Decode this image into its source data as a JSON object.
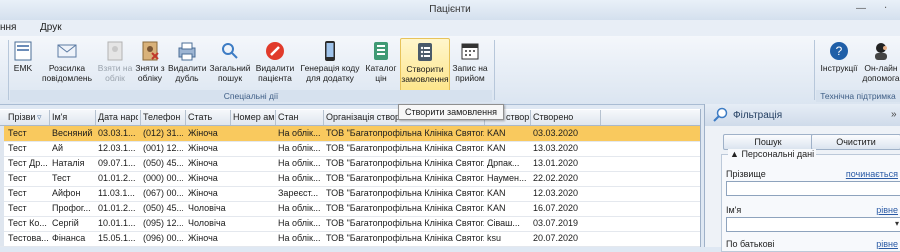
{
  "window": {
    "title": "Пацієнти"
  },
  "menu": [
    "ння",
    "Друк"
  ],
  "ribbon": {
    "buttons": [
      {
        "label": "EMK",
        "icon": "emk-icon",
        "disabled": false
      },
      {
        "label": "Розсилка повідомлень",
        "icon": "envelope-icon",
        "disabled": false
      },
      {
        "label": "Взяти на облік",
        "icon": "take-record-icon",
        "disabled": true
      },
      {
        "label": "Зняти з обліку",
        "icon": "remove-record-icon",
        "disabled": false
      },
      {
        "label": "Видалити дубль",
        "icon": "printer-icon",
        "disabled": false
      },
      {
        "label": "Загальний пошук",
        "icon": "search-icon",
        "disabled": false
      },
      {
        "label": "Видалити пацієнта",
        "icon": "delete-icon",
        "disabled": false
      },
      {
        "label": "Генерація коду для додатку",
        "icon": "phone-icon",
        "disabled": false
      },
      {
        "label": "Каталог цін",
        "icon": "catalog-icon",
        "disabled": false
      },
      {
        "label": "Створити замовлення",
        "icon": "order-icon",
        "disabled": false,
        "active": true
      },
      {
        "label": "Запис на прийом",
        "icon": "calendar-icon",
        "disabled": false
      }
    ],
    "group_special": "Спеціальні дії",
    "right_buttons": [
      {
        "label": "Інструкції",
        "icon": "help-icon"
      },
      {
        "label": "Он-лайн допомога",
        "icon": "online-help-icon"
      }
    ],
    "group_support": "Технічна підтримка"
  },
  "tooltip": "Створити замовлення",
  "grid": {
    "columns": [
      "Прізви",
      "Ім'я",
      "Дата нарс",
      "Телефон",
      "Стать",
      "Номер ам",
      "Стан",
      "Організація створ",
      "створ",
      "Створено"
    ],
    "rows": [
      [
        "Тест",
        "Весняний",
        "03.03.1...",
        "(012) 31...",
        "Жіноча",
        "",
        "На облік...",
        "ТОВ \"Багатопрофільна Клініка Святог...",
        "KAN",
        "03.03.2020"
      ],
      [
        "Тест",
        "Ай",
        "12.03.1...",
        "(001) 12...",
        "Жіноча",
        "",
        "На облік...",
        "ТОВ \"Багатопрофільна Клініка Святог...",
        "KAN",
        "13.03.2020"
      ],
      [
        "Тест Др...",
        "Наталія",
        "09.07.1...",
        "(050) 45...",
        "Жіноча",
        "",
        "На облік...",
        "ТОВ \"Багатопрофільна Клініка Святог...",
        "Дрпак...",
        "13.01.2020"
      ],
      [
        "Тест",
        "Тест",
        "01.01.2...",
        "(000) 00...",
        "Жіноча",
        "",
        "На облік...",
        "ТОВ \"Багатопрофільна Клініка Святог...",
        "Наумен...",
        "22.02.2020"
      ],
      [
        "Тест",
        "Айфон",
        "11.03.1...",
        "(067) 00...",
        "Жіноча",
        "",
        "Зареєст...",
        "ТОВ \"Багатопрофільна Клініка Святог...",
        "KAN",
        "12.03.2020"
      ],
      [
        "Тест",
        "Профог...",
        "01.01.2...",
        "(050) 45...",
        "Чоловіча",
        "",
        "На облік...",
        "ТОВ \"Багатопрофільна Клініка Святог...",
        "KAN",
        "16.07.2020"
      ],
      [
        "Тест Ко...",
        "Сергій",
        "10.01.1...",
        "(095) 12...",
        "Чоловіча",
        "",
        "На облік...",
        "ТОВ \"Багатопрофільна Клініка Святог...",
        "Сіваш...",
        "03.07.2019"
      ],
      [
        "Тестова...",
        "Фінанса",
        "15.05.1...",
        "(096) 00...",
        "Жіноча",
        "",
        "На облік...",
        "ТОВ \"Багатопрофільна Клініка Святог...",
        "ksu",
        "20.07.2020"
      ]
    ]
  },
  "filter": {
    "title": "Фільтрація",
    "search": "Пошук",
    "clear": "Очистити",
    "section": "Персональні дані",
    "fields": [
      {
        "label": "Прізвище",
        "mode": "починається"
      },
      {
        "label": "Ім'я",
        "mode": "рівне"
      },
      {
        "label": "По батькові",
        "mode": "рівне"
      }
    ]
  },
  "colors": {
    "accent": "#f9c95e",
    "ribbon_group": "#3d5d85",
    "link": "#2a5aa5"
  }
}
